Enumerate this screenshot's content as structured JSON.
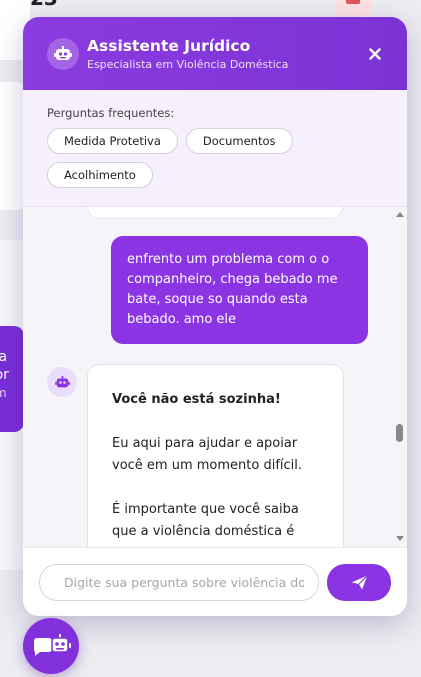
{
  "background": {
    "top_number": "23",
    "side_text": [
      "stra",
      "ssor",
      "crim"
    ]
  },
  "chat": {
    "title": "Assistente Jurídico",
    "subtitle": "Especialista em Violência Doméstica",
    "close_label": "×",
    "faq": {
      "label": "Perguntas frequentes:",
      "chips": [
        "Medida Protetiva",
        "Documentos",
        "Acolhimento"
      ]
    },
    "messages": {
      "user": "enfrento um problema com o o companheiro, chega bebado me bate, soque so quando esta bebado. amo ele",
      "bot_heading": "Você não está sozinha!",
      "bot_p1": "Eu aqui para ajudar e apoiar você em um momento difícil.",
      "bot_p2": "É importante que você saiba que a violência doméstica é um crime"
    },
    "input_placeholder": "Digite sua pergunta sobre violência doméstica..."
  },
  "colors": {
    "primary": "#8a34e4",
    "header": "#7c33d6",
    "faq_bg": "#f6effd"
  },
  "icons": {
    "header": "robot-icon",
    "close": "close-icon",
    "send": "paper-plane-icon",
    "fab": "chat-robot-icon"
  }
}
